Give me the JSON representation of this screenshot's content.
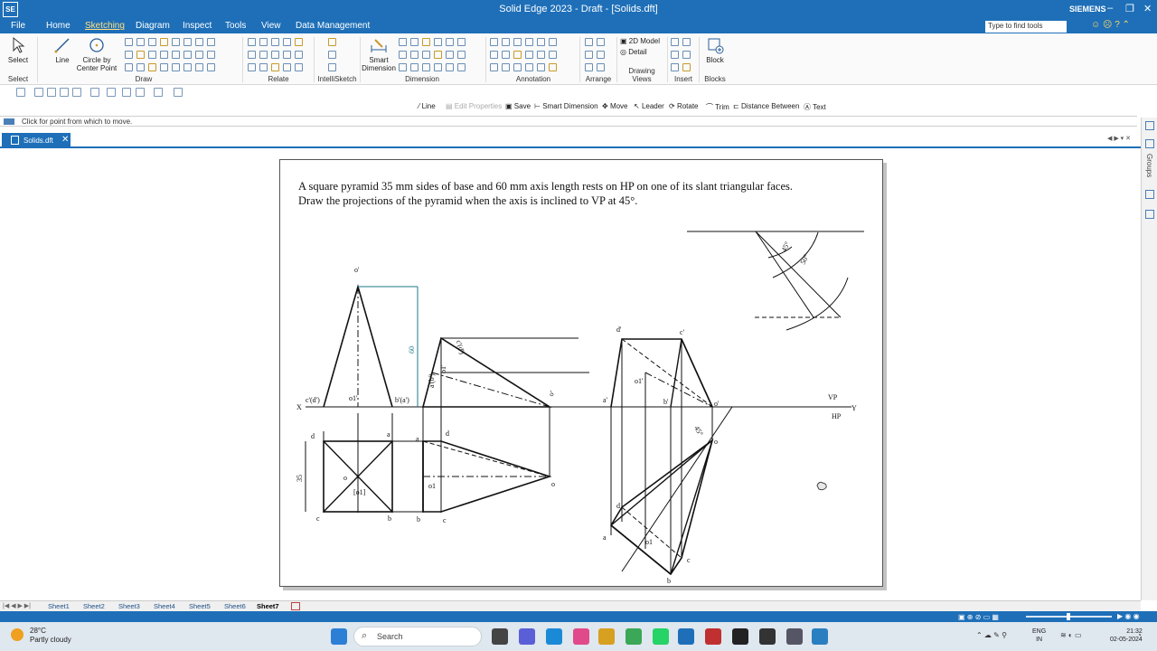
{
  "app": {
    "title": "Solid Edge 2023 - Draft - [Solids.dft]",
    "logo": "SE",
    "brand": "SIEMENS",
    "window_controls": [
      "–",
      "❐",
      "✕"
    ]
  },
  "menu": {
    "items": [
      "File",
      "Home",
      "Sketching",
      "Diagram",
      "Inspect",
      "Tools",
      "View",
      "Data Management"
    ],
    "active": "Sketching",
    "search_placeholder": "Type to find tools"
  },
  "ribbon": {
    "groups": [
      "Select",
      "Draw",
      "Relate",
      "IntelliSketch",
      "Dimension",
      "Annotation",
      "Arrange",
      "Drawing Views",
      "Insert",
      "Blocks"
    ],
    "select_label": "Select",
    "line_label": "Line",
    "circle_label_1": "Circle by",
    "circle_label_2": "Center Point",
    "smart_dim_label_1": "Smart",
    "smart_dim_label_2": "Dimension",
    "model_2d_label": "2D Model",
    "detail_label": "Detail",
    "block_label": "Block"
  },
  "command_bar": {
    "items": [
      "Line",
      "Edit Properties",
      "Save",
      "Smart Dimension",
      "Move",
      "Leader",
      "Rotate",
      "Trim",
      "Distance Between",
      "Text"
    ],
    "disabled": [
      "Edit Properties"
    ]
  },
  "prompt": {
    "text": "Click for point from which to move."
  },
  "document": {
    "tab": "Solids.dft",
    "groups_label": "Groups"
  },
  "problem": {
    "line1": "A square pyramid 35 mm sides of base and 60 mm axis length rests on HP on one of its slant triangular faces.",
    "line2": "Draw the projections of the pyramid when the axis is inclined to VP at 45°."
  },
  "drawing_labels": {
    "x": "X",
    "y": "Y",
    "vp": "VP",
    "hp": "HP",
    "dim_60": "60",
    "dim_35": "35",
    "angle_45": "45°",
    "angle_50": "50°",
    "o_prime": "o'",
    "c_d_prime": "c'(d')",
    "o1_prime": "o1'",
    "b_a_prime": "b'(a')",
    "d": "d",
    "a": "a",
    "b": "b",
    "c": "c",
    "o": "o",
    "o1_bracket": "[o1]",
    "o1": "o1",
    "d_prime": "d'",
    "c_prime": "c'",
    "a_prime": "a'",
    "b_prime": "b'",
    "c_d_slant": "c'(d')",
    "a_b_slant": "a'(b')",
    "o1_slant": "o1'"
  },
  "sheet_tabs": {
    "items": [
      "Sheet1",
      "Sheet2",
      "Sheet3",
      "Sheet4",
      "Sheet5",
      "Sheet6",
      "Sheet7"
    ],
    "active": "Sheet7"
  },
  "taskbar": {
    "temperature": "28°C",
    "weather": "Partly cloudy",
    "search_label": "Search",
    "lang_1": "ENG",
    "lang_2": "IN",
    "time": "21:32",
    "date": "02-05-2024"
  }
}
